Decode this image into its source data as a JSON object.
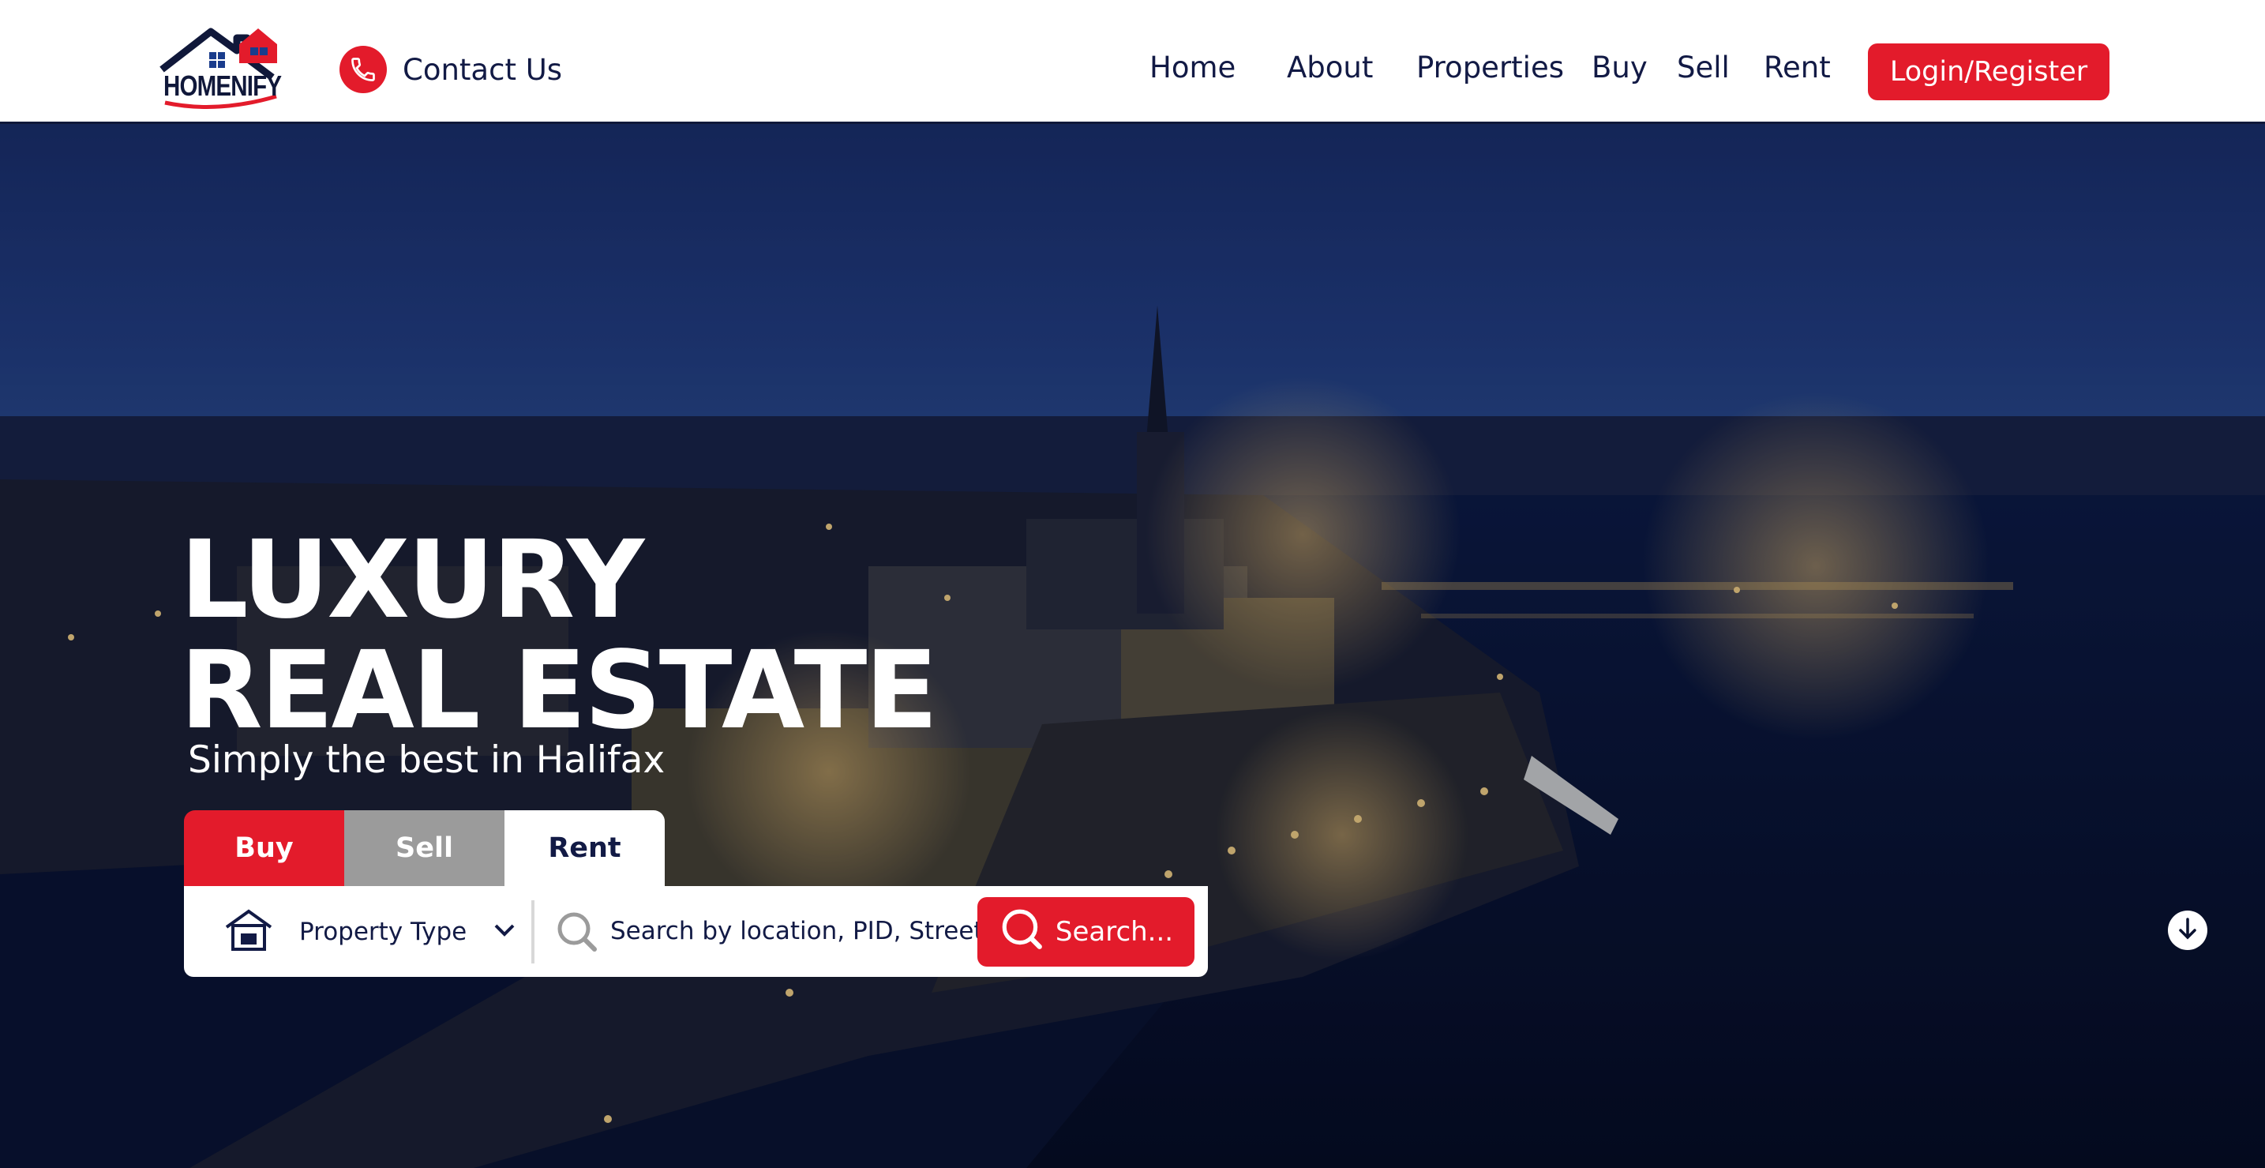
{
  "brand": {
    "name": "HOMENIFY"
  },
  "header": {
    "contact_label": "Contact Us",
    "nav": [
      "Home",
      "About",
      "Properties",
      "Buy",
      "Sell",
      "Rent"
    ],
    "login_label": "Login/Register"
  },
  "hero": {
    "title_line1": "LUXURY",
    "title_line2": "REAL ESTATE",
    "subtitle": "Simply the best in Halifax",
    "tabs": [
      "Buy",
      "Sell",
      "Rent"
    ],
    "selected_tab": "Buy",
    "property_type_label": "Property Type",
    "search_placeholder": "Search by location, PID, Street...",
    "search_button": "Search..."
  },
  "icons": {
    "contact": "phone-icon",
    "property_type": "house-icon",
    "property_type_toggle": "chevron-down-icon",
    "search_field": "search-icon",
    "search_button": "search-icon",
    "scroll": "arrow-down-circle-icon"
  },
  "colors": {
    "accent": "#e31b2b",
    "navy": "#121a45",
    "tab_inactive": "#9b9b9b"
  }
}
